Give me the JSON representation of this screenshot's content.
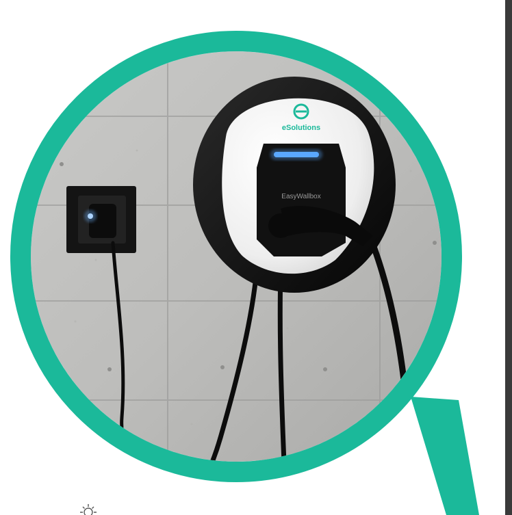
{
  "hero": {
    "brand_name": "eSolutions",
    "device_model": "EasyWallbox"
  },
  "colors": {
    "accent": "#1bb99a",
    "side_panel": "#3a3a3a",
    "background": "#ffffff",
    "led": "#5aa8ff"
  },
  "icons": {
    "charger": "ev-charger-icon",
    "socket": "wall-socket-icon",
    "gear": "gear-icon"
  }
}
